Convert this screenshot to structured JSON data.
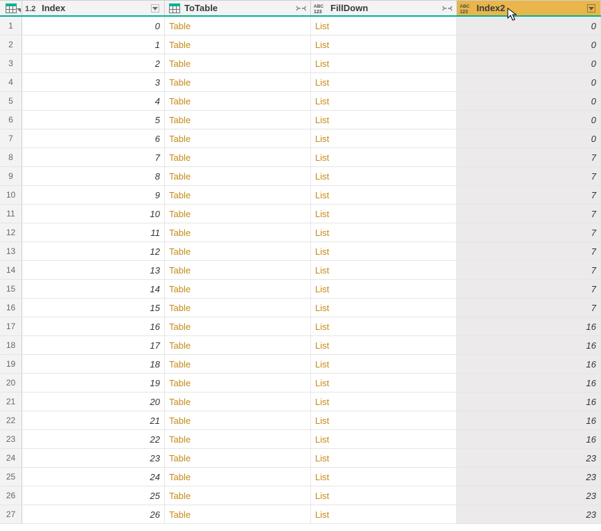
{
  "columns": {
    "index": {
      "label": "Index",
      "type": "decimal"
    },
    "totable": {
      "label": "ToTable",
      "type": "table"
    },
    "filldown": {
      "label": "FillDown",
      "type": "any"
    },
    "index2": {
      "label": "Index2",
      "type": "any",
      "selected": true
    }
  },
  "rows": [
    {
      "n": 1,
      "index": 0,
      "totable": "Table",
      "filldown": "List",
      "index2": 0
    },
    {
      "n": 2,
      "index": 1,
      "totable": "Table",
      "filldown": "List",
      "index2": 0
    },
    {
      "n": 3,
      "index": 2,
      "totable": "Table",
      "filldown": "List",
      "index2": 0
    },
    {
      "n": 4,
      "index": 3,
      "totable": "Table",
      "filldown": "List",
      "index2": 0
    },
    {
      "n": 5,
      "index": 4,
      "totable": "Table",
      "filldown": "List",
      "index2": 0
    },
    {
      "n": 6,
      "index": 5,
      "totable": "Table",
      "filldown": "List",
      "index2": 0
    },
    {
      "n": 7,
      "index": 6,
      "totable": "Table",
      "filldown": "List",
      "index2": 0
    },
    {
      "n": 8,
      "index": 7,
      "totable": "Table",
      "filldown": "List",
      "index2": 7
    },
    {
      "n": 9,
      "index": 8,
      "totable": "Table",
      "filldown": "List",
      "index2": 7
    },
    {
      "n": 10,
      "index": 9,
      "totable": "Table",
      "filldown": "List",
      "index2": 7
    },
    {
      "n": 11,
      "index": 10,
      "totable": "Table",
      "filldown": "List",
      "index2": 7
    },
    {
      "n": 12,
      "index": 11,
      "totable": "Table",
      "filldown": "List",
      "index2": 7
    },
    {
      "n": 13,
      "index": 12,
      "totable": "Table",
      "filldown": "List",
      "index2": 7
    },
    {
      "n": 14,
      "index": 13,
      "totable": "Table",
      "filldown": "List",
      "index2": 7
    },
    {
      "n": 15,
      "index": 14,
      "totable": "Table",
      "filldown": "List",
      "index2": 7
    },
    {
      "n": 16,
      "index": 15,
      "totable": "Table",
      "filldown": "List",
      "index2": 7
    },
    {
      "n": 17,
      "index": 16,
      "totable": "Table",
      "filldown": "List",
      "index2": 16
    },
    {
      "n": 18,
      "index": 17,
      "totable": "Table",
      "filldown": "List",
      "index2": 16
    },
    {
      "n": 19,
      "index": 18,
      "totable": "Table",
      "filldown": "List",
      "index2": 16
    },
    {
      "n": 20,
      "index": 19,
      "totable": "Table",
      "filldown": "List",
      "index2": 16
    },
    {
      "n": 21,
      "index": 20,
      "totable": "Table",
      "filldown": "List",
      "index2": 16
    },
    {
      "n": 22,
      "index": 21,
      "totable": "Table",
      "filldown": "List",
      "index2": 16
    },
    {
      "n": 23,
      "index": 22,
      "totable": "Table",
      "filldown": "List",
      "index2": 16
    },
    {
      "n": 24,
      "index": 23,
      "totable": "Table",
      "filldown": "List",
      "index2": 23
    },
    {
      "n": 25,
      "index": 24,
      "totable": "Table",
      "filldown": "List",
      "index2": 23
    },
    {
      "n": 26,
      "index": 25,
      "totable": "Table",
      "filldown": "List",
      "index2": 23
    },
    {
      "n": 27,
      "index": 26,
      "totable": "Table",
      "filldown": "List",
      "index2": 23
    }
  ]
}
